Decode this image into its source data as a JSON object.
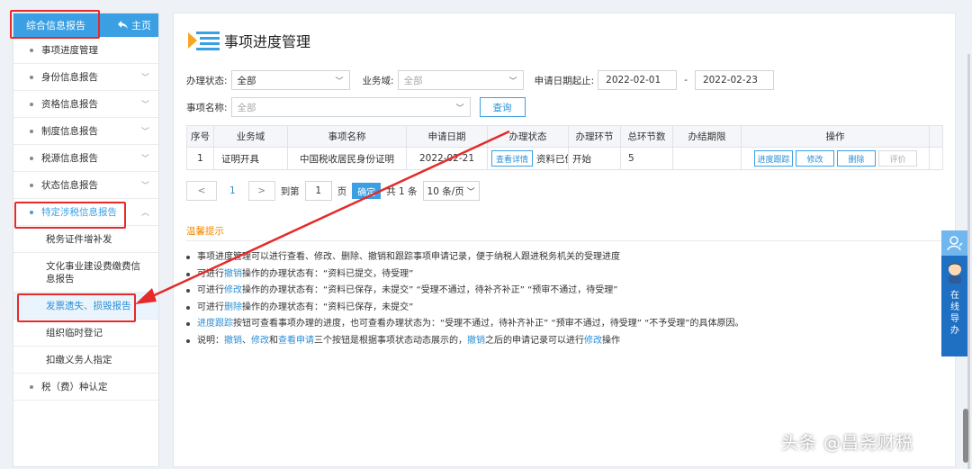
{
  "sidebar": {
    "title": "综合信息报告",
    "home": "主页",
    "items": [
      {
        "label": "事项进度管理",
        "chevron": false
      },
      {
        "label": "身份信息报告",
        "chevron": true
      },
      {
        "label": "资格信息报告",
        "chevron": true
      },
      {
        "label": "制度信息报告",
        "chevron": true
      },
      {
        "label": "税源信息报告",
        "chevron": true
      },
      {
        "label": "状态信息报告",
        "chevron": true
      }
    ],
    "open_group": "特定涉税信息报告",
    "sub_items": [
      "税务证件增补发",
      "文化事业建设费缴费信息报告",
      "发票遗失、损毁报告",
      "组织临时登记",
      "扣缴义务人指定"
    ],
    "last_item": "税（费）种认定"
  },
  "main": {
    "title": "事项进度管理",
    "filters": {
      "status_label": "办理状态:",
      "status_value": "全部",
      "domain_label": "业务域:",
      "domain_value": "全部",
      "date_label": "申请日期起止:",
      "date_from": "2022-02-01",
      "date_sep": "-",
      "date_to": "2022-02-23",
      "item_label": "事项名称:",
      "item_value": "全部",
      "query_button": "查询"
    },
    "table": {
      "headers": [
        "序号",
        "业务域",
        "事项名称",
        "申请日期",
        "办理状态",
        "办理环节",
        "总环节数",
        "办结期限",
        "操作"
      ],
      "rows": [
        {
          "no": "1",
          "domain": "证明开具",
          "name": "中国税收居民身份证明",
          "date": "2022-02-21",
          "status_btn": "查看详情",
          "status": "资料已保存",
          "step": "开始",
          "total": "5",
          "deadline": ""
        }
      ],
      "actions": [
        "进度跟踪",
        "修改",
        "删除",
        "评价"
      ]
    },
    "pager": {
      "prev": "<",
      "current": "1",
      "next": ">",
      "goto_label": "到第",
      "goto_value": "1",
      "page_unit": "页",
      "confirm": "确定",
      "total": "共 1 条",
      "size": "10 条/页"
    },
    "tips": {
      "title": "温馨提示",
      "lines": [
        {
          "parts": [
            {
              "t": "事项进度管理可以进行查看、修改、删除、撤销和跟踪事项申请记录，便于纳税人跟进税务机关的受理进度",
              "link": false
            }
          ]
        },
        {
          "parts": [
            {
              "t": "可进行",
              "link": false
            },
            {
              "t": "撤销",
              "link": true
            },
            {
              "t": "操作的办理状态有：“资料已提交，待受理”",
              "link": false
            }
          ]
        },
        {
          "parts": [
            {
              "t": "可进行",
              "link": false
            },
            {
              "t": "修改",
              "link": true
            },
            {
              "t": "操作的办理状态有：“资料已保存，未提交”  “受理不通过，待补齐补正”  “预审不通过，待受理”",
              "link": false
            }
          ]
        },
        {
          "parts": [
            {
              "t": "可进行",
              "link": false
            },
            {
              "t": "删除",
              "link": true
            },
            {
              "t": "操作的办理状态有：“资料已保存，未提交”",
              "link": false
            }
          ]
        },
        {
          "parts": [
            {
              "t": "进度跟踪",
              "link": true
            },
            {
              "t": "按钮可查看事项办理的进度，也可查看办理状态为：“受理不通过，待补齐补正”  “预审不通过，待受理”  “不予受理”的具体原因。",
              "link": false
            }
          ]
        },
        {
          "parts": [
            {
              "t": "说明：",
              "link": false
            },
            {
              "t": "撤销",
              "link": true
            },
            {
              "t": "、",
              "link": false
            },
            {
              "t": "修改",
              "link": true
            },
            {
              "t": "和",
              "link": false
            },
            {
              "t": "查看申请",
              "link": true
            },
            {
              "t": "三个按钮是根据事项状态动态展示的，",
              "link": false
            },
            {
              "t": "撤销",
              "link": true
            },
            {
              "t": "之后的申请记录可以进行",
              "link": false
            },
            {
              "t": "修改",
              "link": true
            },
            {
              "t": "操作",
              "link": false
            }
          ]
        }
      ]
    }
  },
  "float_panel": {
    "chars": [
      "在",
      "线",
      "导",
      "办"
    ]
  },
  "watermark": "头条 @昌尧财税",
  "colors": {
    "accent": "#3aa0e3",
    "highlight": "#e52a2a",
    "tip_title": "#f08a00",
    "float": "#1f6fc2"
  }
}
